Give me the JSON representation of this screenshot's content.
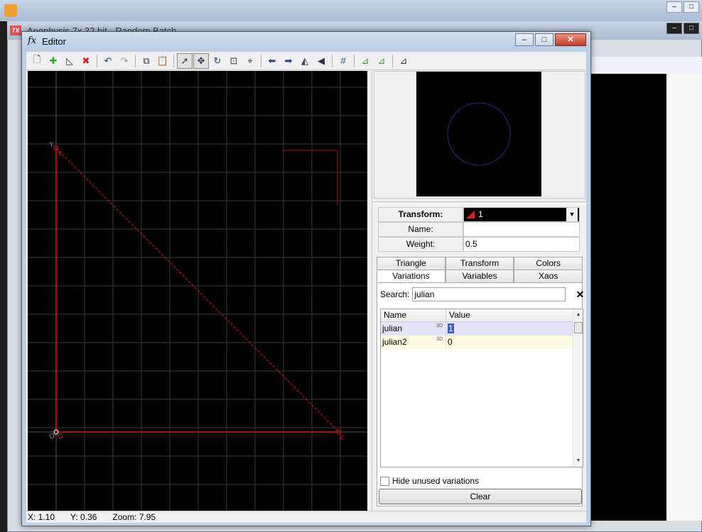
{
  "background": {
    "app_title": "Apophysis 7x 32 bit - Random Batch",
    "app_icon_label": "7X"
  },
  "editor": {
    "title": "Editor",
    "title_icon": "fx",
    "window_controls": {
      "minimize": "–",
      "maximize": "□",
      "close": "✕"
    },
    "toolbar_icons": [
      "new-icon",
      "add-triangle-icon",
      "duplicate-icon",
      "delete-icon",
      "undo-icon",
      "redo-icon",
      "copy-icon",
      "paste-icon",
      "select-mode-icon",
      "move-mode-icon",
      "rotate-mode-icon",
      "scale-mode-icon",
      "pivot-mode-icon",
      "rotate-left-icon",
      "rotate-right-icon",
      "flip-horizontal-icon",
      "flip-vertical-icon",
      "grid-icon",
      "post-transform-icon",
      "reset-icon",
      "final-transform-icon"
    ],
    "canvas": {
      "grid_color": "#3a3a3a",
      "triangle_color": "#d01a1a",
      "labels": {
        "y": "Y",
        "o": "O",
        "x": "X"
      }
    },
    "status": {
      "x": "X: 1.10",
      "y": "Y: 0.36",
      "zoom": "Zoom: 7.95"
    },
    "preview": {
      "circle_color": "#2a2a8a"
    },
    "transform": {
      "transform_label": "Transform:",
      "transform_value": "1",
      "name_label": "Name:",
      "name_value": "",
      "weight_label": "Weight:",
      "weight_value": "0.5"
    },
    "tabs": {
      "row1": [
        "Triangle",
        "Transform",
        "Colors"
      ],
      "row2": [
        "Variations",
        "Variables",
        "Xaos"
      ],
      "selected": "Variations"
    },
    "variations": {
      "search_label": "Search:",
      "search_value": "julian",
      "clear_x": "✕",
      "col_name": "Name",
      "col_value": "Value",
      "rows": [
        {
          "name": "julian",
          "badge": "3D",
          "value": "1"
        },
        {
          "name": "julian2",
          "badge": "3D",
          "value": "0"
        }
      ],
      "hide_unused_label": "Hide unused variations",
      "clear_button": "Clear"
    }
  }
}
